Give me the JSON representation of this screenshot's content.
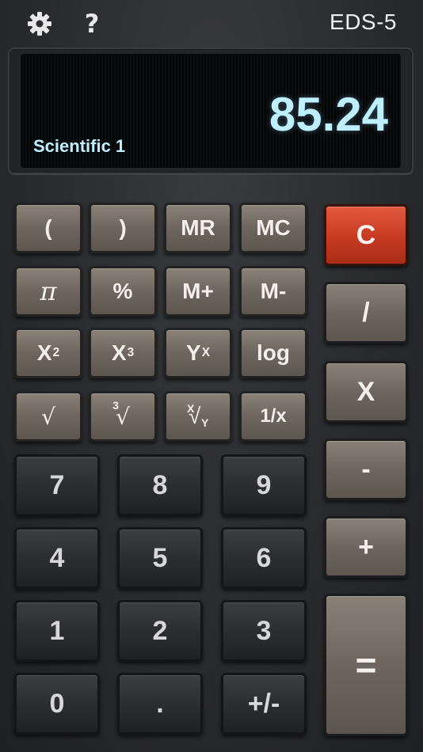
{
  "header": {
    "brand": "EDS-5",
    "help_label": "?"
  },
  "display": {
    "value": "85.24",
    "mode": "Scientific 1"
  },
  "keys": {
    "open_paren": "(",
    "close_paren": ")",
    "mr": "MR",
    "mc": "MC",
    "clear": "C",
    "pi": "π",
    "percent": "%",
    "m_plus": "M+",
    "m_minus": "M-",
    "divide": "/",
    "x_base": "X",
    "x2_exp": "2",
    "x3_exp": "3",
    "y_base": "Y",
    "yx_exp": "X",
    "log": "log",
    "multiply": "X",
    "sqrt": "√",
    "cbrt_index": "3",
    "cbrt_sym": "√",
    "xroot_x": "X",
    "xroot_sym": "√",
    "xroot_y": "Y",
    "reciprocal": "1/x",
    "minus": "-",
    "n7": "7",
    "n8": "8",
    "n9": "9",
    "plus": "+",
    "n4": "4",
    "n5": "5",
    "n6": "6",
    "n1": "1",
    "n2": "2",
    "n3": "3",
    "equals": "=",
    "n0": "0",
    "dot": ".",
    "negate": "+/-"
  }
}
